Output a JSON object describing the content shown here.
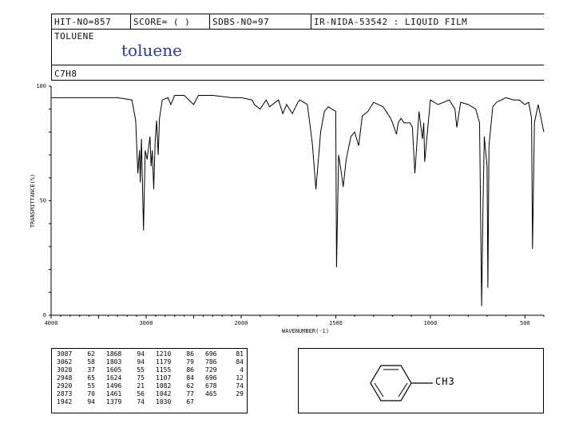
{
  "header": {
    "hit_no": "HIT-NO=857",
    "score": "SCORE=  (  )",
    "sdbs_no": "SDBS-NO=97",
    "ir_info": "IR-NIDA-53542 : LIQUID FILM",
    "compound_name": "TOLUENE",
    "formula": "C7H8"
  },
  "title_overlay": "toluene",
  "structure": {
    "substituent": "CH3"
  },
  "chart_data": {
    "type": "line",
    "ylabel": "TRANSMITTANCE(%)",
    "xlabel": "WAVENUMBER(-1)",
    "xlim": [
      4000,
      400
    ],
    "ylim": [
      0,
      100
    ],
    "x_ticks": [
      "4000",
      "3000",
      "2000",
      "1500",
      "1000",
      "500"
    ],
    "y_ticks": [
      "100",
      "50",
      "0"
    ],
    "series": [
      {
        "x": [
          4000,
          3700,
          3300,
          3150,
          3110,
          3087,
          3070,
          3062,
          3050,
          3028,
          3010,
          2990,
          2960,
          2948,
          2935,
          2920,
          2905,
          2890,
          2873,
          2860,
          2830,
          2770,
          2740,
          2700,
          2600,
          2500,
          2450,
          2300,
          2100,
          2000,
          1942,
          1930,
          1900,
          1868,
          1850,
          1803,
          1780,
          1760,
          1730,
          1700,
          1690,
          1650,
          1624,
          1605,
          1580,
          1560,
          1540,
          1500,
          1496,
          1485,
          1470,
          1461,
          1445,
          1420,
          1400,
          1379,
          1360,
          1330,
          1300,
          1250,
          1210,
          1200,
          1179,
          1170,
          1155,
          1140,
          1107,
          1095,
          1082,
          1060,
          1042,
          1035,
          1030,
          1000,
          960,
          900,
          870,
          860,
          840,
          800,
          780,
          760,
          740,
          729,
          722,
          715,
          700,
          696,
          690,
          670,
          650,
          600,
          560,
          530,
          500,
          480,
          465,
          460,
          450,
          430,
          400
        ],
        "y": [
          95,
          95,
          95,
          94,
          85,
          62,
          72,
          58,
          77,
          37,
          72,
          68,
          78,
          65,
          72,
          55,
          76,
          85,
          70,
          86,
          94,
          95,
          92,
          96,
          96,
          92,
          96,
          96,
          95,
          95,
          94,
          92,
          90,
          94,
          91,
          94,
          88,
          92,
          88,
          93,
          94,
          92,
          75,
          55,
          80,
          89,
          91,
          89,
          21,
          70,
          62,
          56,
          68,
          78,
          80,
          74,
          87,
          89,
          93,
          91,
          86,
          84,
          79,
          84,
          86,
          84,
          84,
          82,
          62,
          89,
          77,
          84,
          67,
          94,
          92,
          94,
          90,
          82,
          93,
          92,
          91,
          90,
          84,
          4,
          45,
          78,
          65,
          12,
          74,
          91,
          93,
          95,
          94,
          94,
          92,
          93,
          86,
          29,
          84,
          92,
          80
        ]
      }
    ],
    "peak_table": [
      [
        "3087",
        "62"
      ],
      [
        "3062",
        "58"
      ],
      [
        "3028",
        "37"
      ],
      [
        "2948",
        "65"
      ],
      [
        "2920",
        "55"
      ],
      [
        "2873",
        "70"
      ],
      [
        "1942",
        "94"
      ],
      [
        "1868",
        "94"
      ],
      [
        "1803",
        "94"
      ],
      [
        "1605",
        "55"
      ],
      [
        "1624",
        "75"
      ],
      [
        "1496",
        "21"
      ],
      [
        "1461",
        "56"
      ],
      [
        "1379",
        "74"
      ],
      [
        "1210",
        "86"
      ],
      [
        "1179",
        "79"
      ],
      [
        "1155",
        "86"
      ],
      [
        "1107",
        "84"
      ],
      [
        "1082",
        "62"
      ],
      [
        "1042",
        "77"
      ],
      [
        "1030",
        "67"
      ],
      [
        "696",
        "81"
      ],
      [
        "786",
        "84"
      ],
      [
        "729",
        "4"
      ],
      [
        "696",
        "12"
      ],
      [
        "678",
        "74"
      ],
      [
        "465",
        "29"
      ]
    ]
  }
}
